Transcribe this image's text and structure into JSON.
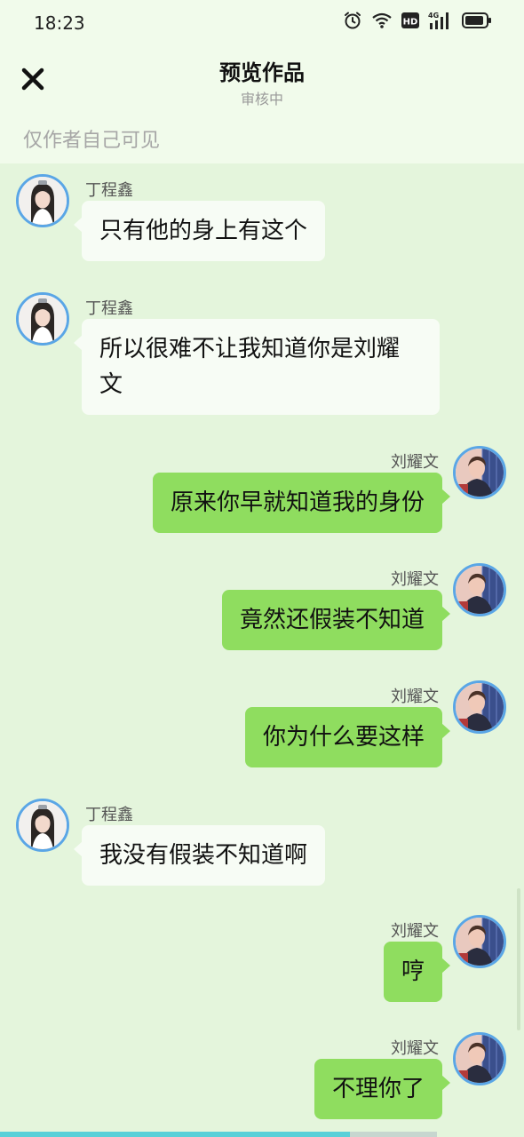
{
  "status_bar": {
    "time": "18:23",
    "icons": [
      "alarm-icon",
      "wifi-icon",
      "hd-icon",
      "signal-4g-icon",
      "battery-icon"
    ],
    "hd_label": "HD",
    "network_label": "4G"
  },
  "header": {
    "close_icon": "close-icon",
    "title": "预览作品",
    "subtitle": "审核中",
    "visibility_note": "仅作者自己可见"
  },
  "messages": [
    {
      "side": "left",
      "sender": "丁程鑫",
      "text": "只有他的身上有这个"
    },
    {
      "side": "left",
      "sender": "丁程鑫",
      "text": "所以很难不让我知道你是刘耀文"
    },
    {
      "side": "right",
      "sender": "刘耀文",
      "text": "原来你早就知道我的身份"
    },
    {
      "side": "right",
      "sender": "刘耀文",
      "text": "竟然还假装不知道"
    },
    {
      "side": "right",
      "sender": "刘耀文",
      "text": "你为什么要这样"
    },
    {
      "side": "left",
      "sender": "丁程鑫",
      "text": "我没有假装不知道啊"
    },
    {
      "side": "right",
      "sender": "刘耀文",
      "text": "哼"
    },
    {
      "side": "right",
      "sender": "刘耀文",
      "text": "不理你了"
    }
  ],
  "progress": {
    "value": 0.8
  },
  "colors": {
    "background": "#e4f5dc",
    "header_background": "#f1fbeb",
    "bubble_left": "#f7fcf5",
    "bubble_right": "#8fdd5f",
    "avatar_border": "#5aa6e6",
    "progress_fill": "#58d0d8"
  }
}
